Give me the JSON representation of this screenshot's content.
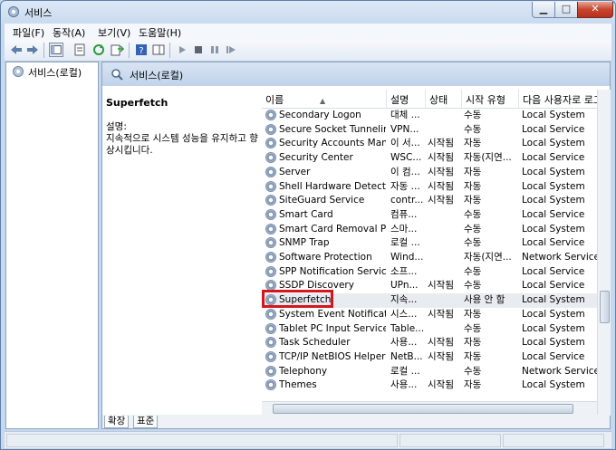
{
  "window": {
    "title": "서비스"
  },
  "menu": [
    "파일(F)",
    "동작(A)",
    "보기(V)",
    "도움말(H)"
  ],
  "tree": {
    "root_label": "서비스(로컬)"
  },
  "pane": {
    "header": "서비스(로컬)"
  },
  "detail": {
    "title": "Superfetch",
    "desc_label": "설명:",
    "desc_text": "지속적으로 시스템 성능을 유지하고 향상시킵니다."
  },
  "columns": [
    "이름",
    "설명",
    "상태",
    "시작 유형",
    "다음 사용자로 로그"
  ],
  "services": [
    {
      "name": "Secondary Logon",
      "desc": "대체 ...",
      "status": "",
      "start": "수동",
      "logon": "Local System"
    },
    {
      "name": "Secure Socket Tunnelin...",
      "desc": "VPN...",
      "status": "",
      "start": "수동",
      "logon": "Local Service"
    },
    {
      "name": "Security Accounts Mana...",
      "desc": "이 서...",
      "status": "시작됨",
      "start": "자동",
      "logon": "Local System"
    },
    {
      "name": "Security Center",
      "desc": "WSC...",
      "status": "시작됨",
      "start": "자동(지연...",
      "logon": "Local Service"
    },
    {
      "name": "Server",
      "desc": "이 컴...",
      "status": "시작됨",
      "start": "자동",
      "logon": "Local System"
    },
    {
      "name": "Shell Hardware Detection",
      "desc": "자동 ...",
      "status": "시작됨",
      "start": "자동",
      "logon": "Local System"
    },
    {
      "name": "SiteGuard Service",
      "desc": "contr...",
      "status": "시작됨",
      "start": "자동",
      "logon": "Local System"
    },
    {
      "name": "Smart Card",
      "desc": "컴퓨...",
      "status": "",
      "start": "수동",
      "logon": "Local Service"
    },
    {
      "name": "Smart Card Removal Po...",
      "desc": "스마...",
      "status": "",
      "start": "수동",
      "logon": "Local System"
    },
    {
      "name": "SNMP Trap",
      "desc": "로컬 ...",
      "status": "",
      "start": "수동",
      "logon": "Local Service"
    },
    {
      "name": "Software Protection",
      "desc": "Wind...",
      "status": "",
      "start": "자동(지연...",
      "logon": "Network Service"
    },
    {
      "name": "SPP Notification Service",
      "desc": "소프...",
      "status": "",
      "start": "수동",
      "logon": "Local Service"
    },
    {
      "name": "SSDP Discovery",
      "desc": "UPn...",
      "status": "시작됨",
      "start": "수동",
      "logon": "Local Service"
    },
    {
      "name": "Superfetch",
      "desc": "지속...",
      "status": "",
      "start": "사용 안 함",
      "logon": "Local System"
    },
    {
      "name": "System Event Notificati...",
      "desc": "시스...",
      "status": "시작됨",
      "start": "자동",
      "logon": "Local System"
    },
    {
      "name": "Tablet PC Input Service",
      "desc": "Table...",
      "status": "",
      "start": "수동",
      "logon": "Local System"
    },
    {
      "name": "Task Scheduler",
      "desc": "사용...",
      "status": "시작됨",
      "start": "자동",
      "logon": "Local System"
    },
    {
      "name": "TCP/IP NetBIOS Helper",
      "desc": "NetB...",
      "status": "시작됨",
      "start": "자동",
      "logon": "Local Service"
    },
    {
      "name": "Telephony",
      "desc": "로컬 ...",
      "status": "",
      "start": "수동",
      "logon": "Network Service"
    },
    {
      "name": "Themes",
      "desc": "사용...",
      "status": "시작됨",
      "start": "자동",
      "logon": "Local System"
    }
  ],
  "tabs": [
    "확장",
    "표준"
  ],
  "colors": {
    "highlight": "#d6161e",
    "selected_row": "#e8ecf1",
    "pane_header": "#c8d9ee"
  }
}
